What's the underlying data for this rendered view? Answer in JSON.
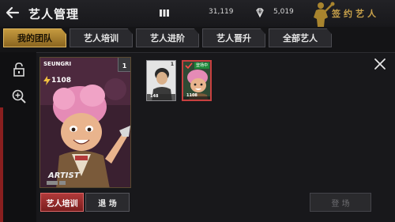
{
  "header": {
    "title": "艺人管理",
    "stat1_value": "31,119",
    "stat2_value": "5,019",
    "signed_label": "签约艺人"
  },
  "tabs": [
    {
      "label": "我的团队",
      "active": true
    },
    {
      "label": "艺人培训",
      "active": false
    },
    {
      "label": "艺人进阶",
      "active": false
    },
    {
      "label": "艺人晋升",
      "active": false
    },
    {
      "label": "全部艺人",
      "active": false
    }
  ],
  "selected_card": {
    "name": "SEUNGRI",
    "rank": "1",
    "power": "1108"
  },
  "actions": {
    "train_label": "艺人培训",
    "exit_label": "退 场",
    "register_label": "登 场"
  },
  "mini_cards": [
    {
      "rank": "1",
      "power": "148"
    },
    {
      "badge": "登场中",
      "power": "1108"
    }
  ],
  "colors": {
    "gold": "#c59a3f",
    "red": "#b13a3a",
    "green_badge": "#1f8a3a"
  }
}
